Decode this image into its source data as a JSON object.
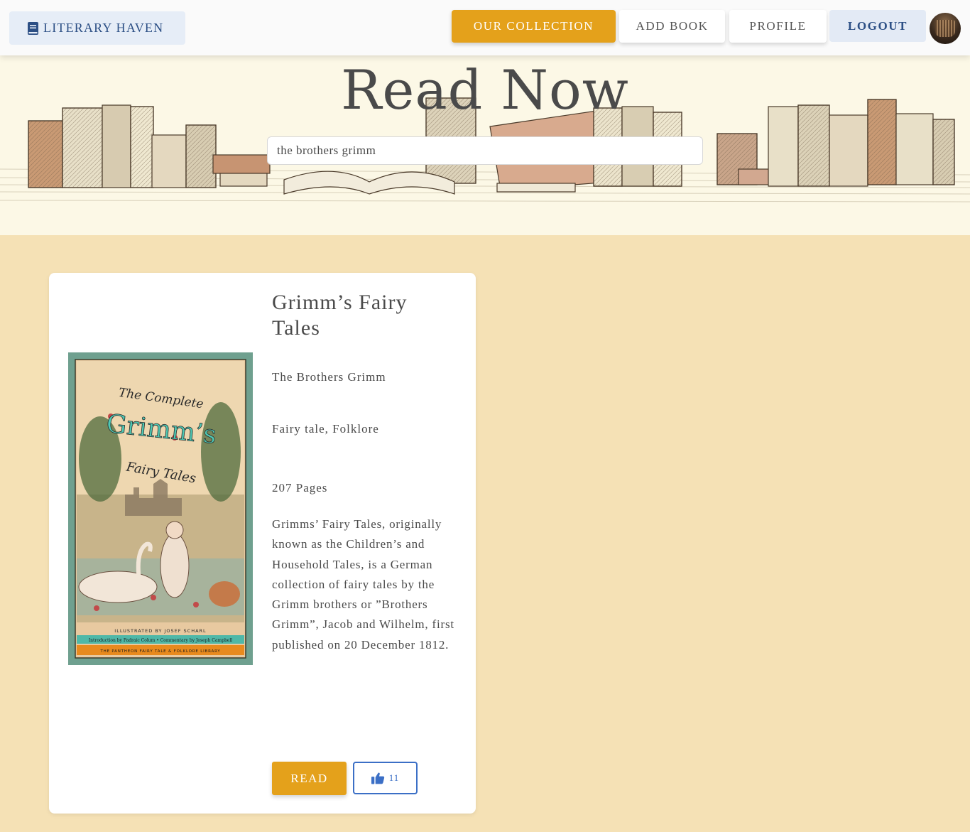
{
  "navbar": {
    "brand_label": "LITERARY HAVEN",
    "brand_icon": "book-icon",
    "items": [
      {
        "label": "OUR COLLECTION"
      },
      {
        "label": "ADD BOOK"
      },
      {
        "label": "PROFILE"
      },
      {
        "label": "LOGOUT"
      }
    ],
    "accent_color": "#e4a11b",
    "brand_color": "#2c4f85"
  },
  "hero": {
    "title": "Read Now",
    "search": {
      "value": "the brothers grimm"
    }
  },
  "book": {
    "title": "Grimm’s Fairy Tales",
    "author": "The Brothers Grimm",
    "genres": "Fairy tale, Folklore",
    "pages": "207 Pages",
    "description": "Grimms’ Fairy Tales, originally known as the Children’s and Household Tales, is a German collection of fairy tales by the Grimm brothers or ”Brothers Grimm”, Jacob and Wilhelm, first published on 20 December 1812.",
    "cover": {
      "line1": "The Complete",
      "line2": "Grimm’s",
      "line3": "Fairy Tales",
      "illustrator": "ILLUSTRATED BY JOSEF SCHARL",
      "intro": "Introduction by Padraic Colum • Commentary by Joseph Campbell",
      "library": "THE PANTHEON FAIRY TALE & FOLKLORE LIBRARY"
    },
    "read_label": "READ",
    "likes": "11",
    "like_icon": "thumbs-up-icon"
  }
}
